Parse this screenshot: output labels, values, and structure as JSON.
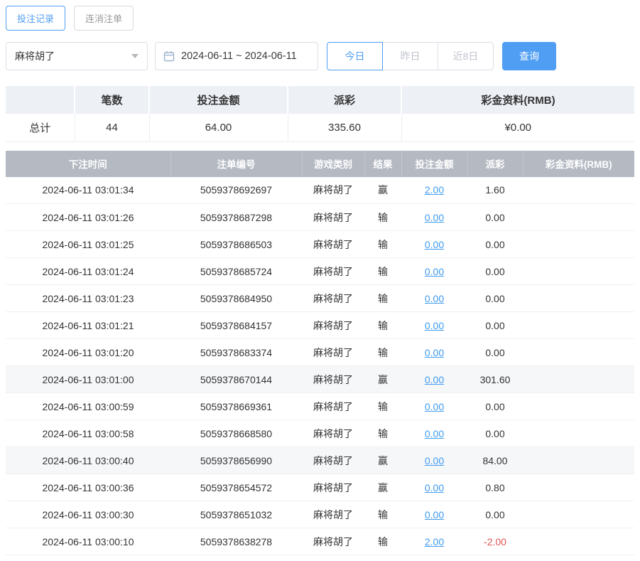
{
  "colors": {
    "accent": "#4f9ef3",
    "link": "#3f9bf0",
    "negative": "#e05252",
    "table_header_bg": "#b4b9c2"
  },
  "tabs": [
    {
      "label": "投注记录",
      "active": true
    },
    {
      "label": "连消注单",
      "active": false
    }
  ],
  "filters": {
    "game": "麻将胡了",
    "date_range": "2024-06-11 ~ 2024-06-11",
    "quick": [
      {
        "label": "今日",
        "active": true
      },
      {
        "label": "昨日",
        "active": false
      },
      {
        "label": "近8日",
        "active": false
      }
    ],
    "query_label": "查询"
  },
  "summary": {
    "headers": [
      "",
      "笔数",
      "投注金额",
      "派彩",
      "彩金资料(RMB)"
    ],
    "values": [
      "总计",
      "44",
      "64.00",
      "335.60",
      "¥0.00"
    ]
  },
  "table": {
    "headers": [
      "下注时间",
      "注单编号",
      "游戏类别",
      "结果",
      "投注金额",
      "派彩",
      "彩金资料(RMB)"
    ],
    "rows": [
      {
        "time": "2024-06-11 03:01:34",
        "order_id": "5059378692697",
        "game": "麻将胡了",
        "result": "赢",
        "bet": "2.00",
        "payout": "1.60",
        "bonus": "",
        "highlight": false
      },
      {
        "time": "2024-06-11 03:01:26",
        "order_id": "5059378687298",
        "game": "麻将胡了",
        "result": "输",
        "bet": "0.00",
        "payout": "0.00",
        "bonus": "",
        "highlight": false
      },
      {
        "time": "2024-06-11 03:01:25",
        "order_id": "5059378686503",
        "game": "麻将胡了",
        "result": "输",
        "bet": "0.00",
        "payout": "0.00",
        "bonus": "",
        "highlight": false
      },
      {
        "time": "2024-06-11 03:01:24",
        "order_id": "5059378685724",
        "game": "麻将胡了",
        "result": "输",
        "bet": "0.00",
        "payout": "0.00",
        "bonus": "",
        "highlight": false
      },
      {
        "time": "2024-06-11 03:01:23",
        "order_id": "5059378684950",
        "game": "麻将胡了",
        "result": "输",
        "bet": "0.00",
        "payout": "0.00",
        "bonus": "",
        "highlight": false
      },
      {
        "time": "2024-06-11 03:01:21",
        "order_id": "5059378684157",
        "game": "麻将胡了",
        "result": "输",
        "bet": "0.00",
        "payout": "0.00",
        "bonus": "",
        "highlight": false
      },
      {
        "time": "2024-06-11 03:01:20",
        "order_id": "5059378683374",
        "game": "麻将胡了",
        "result": "输",
        "bet": "0.00",
        "payout": "0.00",
        "bonus": "",
        "highlight": false
      },
      {
        "time": "2024-06-11 03:01:00",
        "order_id": "5059378670144",
        "game": "麻将胡了",
        "result": "赢",
        "bet": "0.00",
        "payout": "301.60",
        "bonus": "",
        "highlight": true
      },
      {
        "time": "2024-06-11 03:00:59",
        "order_id": "5059378669361",
        "game": "麻将胡了",
        "result": "输",
        "bet": "0.00",
        "payout": "0.00",
        "bonus": "",
        "highlight": false
      },
      {
        "time": "2024-06-11 03:00:58",
        "order_id": "5059378668580",
        "game": "麻将胡了",
        "result": "输",
        "bet": "0.00",
        "payout": "0.00",
        "bonus": "",
        "highlight": false
      },
      {
        "time": "2024-06-11 03:00:40",
        "order_id": "5059378656990",
        "game": "麻将胡了",
        "result": "赢",
        "bet": "0.00",
        "payout": "84.00",
        "bonus": "",
        "highlight": true
      },
      {
        "time": "2024-06-11 03:00:36",
        "order_id": "5059378654572",
        "game": "麻将胡了",
        "result": "赢",
        "bet": "0.00",
        "payout": "0.80",
        "bonus": "",
        "highlight": false
      },
      {
        "time": "2024-06-11 03:00:30",
        "order_id": "5059378651032",
        "game": "麻将胡了",
        "result": "输",
        "bet": "0.00",
        "payout": "0.00",
        "bonus": "",
        "highlight": false
      },
      {
        "time": "2024-06-11 03:00:10",
        "order_id": "5059378638278",
        "game": "麻将胡了",
        "result": "输",
        "bet": "2.00",
        "payout": "-2.00",
        "bonus": "",
        "highlight": false
      }
    ]
  }
}
